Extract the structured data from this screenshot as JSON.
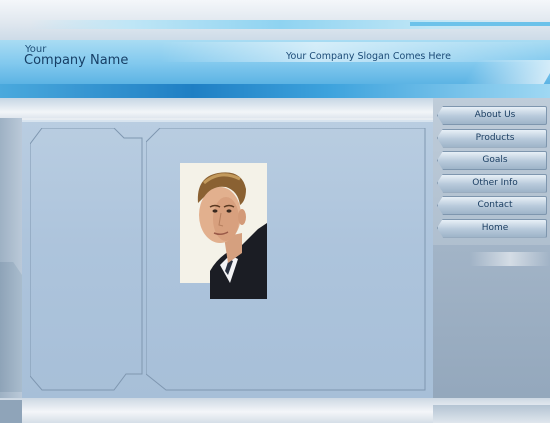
{
  "header": {
    "company_prefix": "Your",
    "company_name": "Company Name",
    "slogan": "Your Company Slogan Comes Here"
  },
  "nav": {
    "items": [
      {
        "label": "About Us"
      },
      {
        "label": "Products"
      },
      {
        "label": "Goals"
      },
      {
        "label": "Other Info"
      },
      {
        "label": "Contact"
      },
      {
        "label": "Home"
      }
    ]
  },
  "colors": {
    "banner_light": "#a9dcf3",
    "banner_dark": "#1f7fc4",
    "panel": "#adc4dc",
    "nav_text": "#1c3f63"
  }
}
